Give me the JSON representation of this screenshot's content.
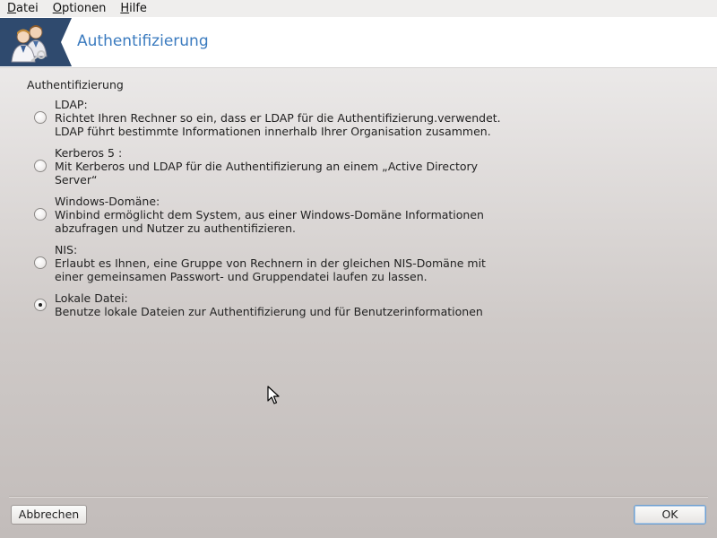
{
  "menubar": {
    "items": [
      {
        "accel": "D",
        "rest": "atei"
      },
      {
        "accel": "O",
        "rest": "ptionen"
      },
      {
        "accel": "H",
        "rest": "ilfe"
      }
    ]
  },
  "header": {
    "title": "Authentifizierung"
  },
  "section": {
    "label": "Authentifizierung"
  },
  "options": [
    {
      "title": "LDAP:",
      "lines": [
        "Richtet Ihren Rechner so ein, dass er LDAP für die Authentifizierung.verwendet.",
        "LDAP führt bestimmte Informationen innerhalb Ihrer Organisation zusammen."
      ],
      "checked": false
    },
    {
      "title": "Kerberos 5 :",
      "lines": [
        "Mit Kerberos und LDAP für die Authentifizierung an einem „Active Directory",
        "Server“"
      ],
      "checked": false
    },
    {
      "title": "Windows-Domäne:",
      "lines": [
        "Winbind ermöglicht dem System, aus einer Windows-Domäne Informationen",
        "abzufragen und Nutzer zu authentifizieren."
      ],
      "checked": false
    },
    {
      "title": "NIS:",
      "lines": [
        "Erlaubt es Ihnen, eine Gruppe von Rechnern in der gleichen NIS-Domäne mit",
        "einer gemeinsamen Passwort- und Gruppendatei laufen zu lassen."
      ],
      "checked": false
    },
    {
      "title": "Lokale Datei:",
      "lines": [
        "Benutze lokale Dateien zur Authentifizierung und für Benutzerinformationen"
      ],
      "checked": true
    }
  ],
  "buttons": {
    "cancel": "Abbrechen",
    "ok": "OK"
  },
  "icons": {
    "logo": "users-key-icon",
    "cursor": "mouse-pointer-icon"
  },
  "colors": {
    "title": "#3b7bbf",
    "logo_bg": "#2f4a6e"
  }
}
